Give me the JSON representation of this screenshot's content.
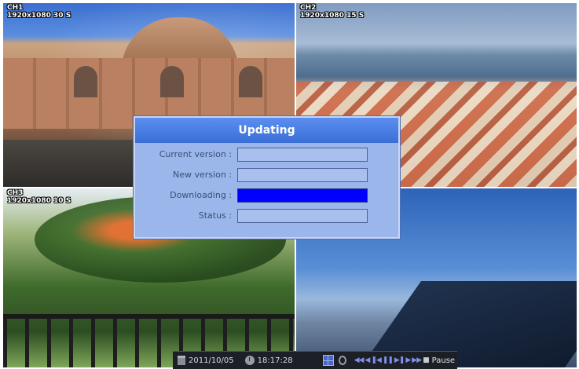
{
  "channels": [
    {
      "id": "CH1",
      "resolution": "1920x1080 30 S"
    },
    {
      "id": "CH2",
      "resolution": "1920x1080 15 S"
    },
    {
      "id": "CH3",
      "resolution": "1920x1080 10 S"
    }
  ],
  "dialog": {
    "title": "Updating",
    "rows": [
      {
        "label": "Current version :",
        "value": ""
      },
      {
        "label": "New version :",
        "value": ""
      },
      {
        "label": "Downloading :",
        "progress": 1.0
      },
      {
        "label": "Status :",
        "value": ""
      }
    ],
    "colors": {
      "title_bg": "#3b6fd6",
      "panel_bg": "#9bb6ea",
      "progress_fill": "#0000ff"
    }
  },
  "statusbar": {
    "date": "2011/10/05",
    "time": "18:17:28",
    "pause_label": "Pause",
    "icons": [
      "calendar-icon",
      "clock-icon",
      "layout-grid-icon",
      "cycle-icon",
      "fast-rewind-icon",
      "rewind-icon",
      "step-back-icon",
      "pause-icon",
      "play-icon",
      "fast-forward-icon",
      "stop-icon"
    ]
  }
}
